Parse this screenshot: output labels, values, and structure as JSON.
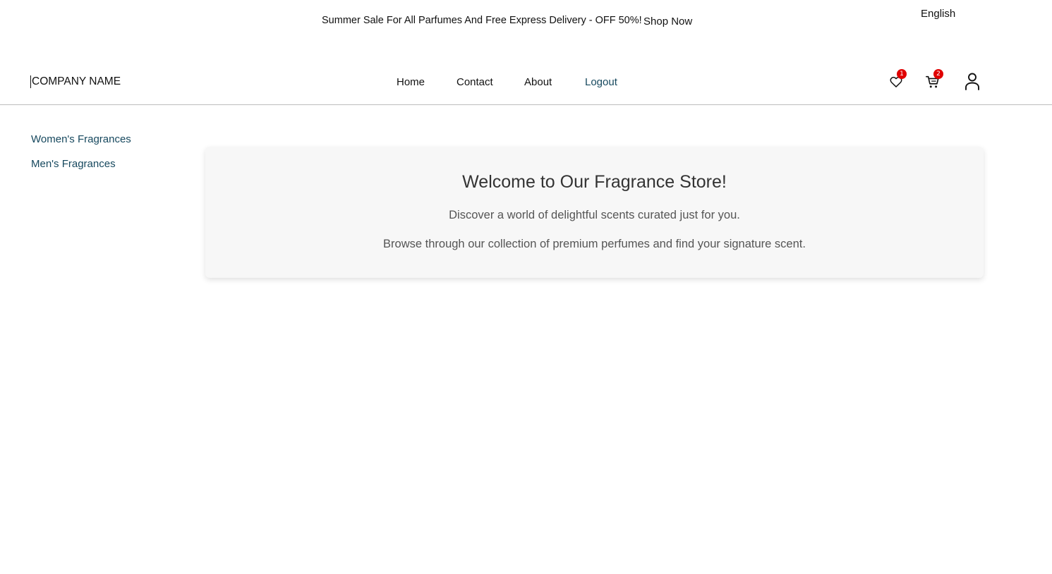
{
  "topbar": {
    "promo_text": "Summer Sale For All Parfumes And Free Express Delivery - OFF 50%!",
    "shop_now_label": "Shop Now",
    "language": "English"
  },
  "header": {
    "logo": "COMPANY NAME",
    "nav": {
      "home": "Home",
      "contact": "Contact",
      "about": "About",
      "logout": "Logout"
    },
    "wishlist_count": "1",
    "cart_count": "2",
    "icons": [
      "heart-icon",
      "cart-icon",
      "user-icon"
    ],
    "accent_color": "#16485e",
    "badge_color": "#e00000"
  },
  "sidebar": {
    "items": [
      {
        "label": "Women's Fragrances"
      },
      {
        "label": "Men's Fragrances"
      }
    ]
  },
  "main": {
    "title": "Welcome to Our Fragrance Store!",
    "line1": "Discover a world of delightful scents curated just for you.",
    "line2": "Browse through our collection of premium perfumes and find your signature scent."
  }
}
